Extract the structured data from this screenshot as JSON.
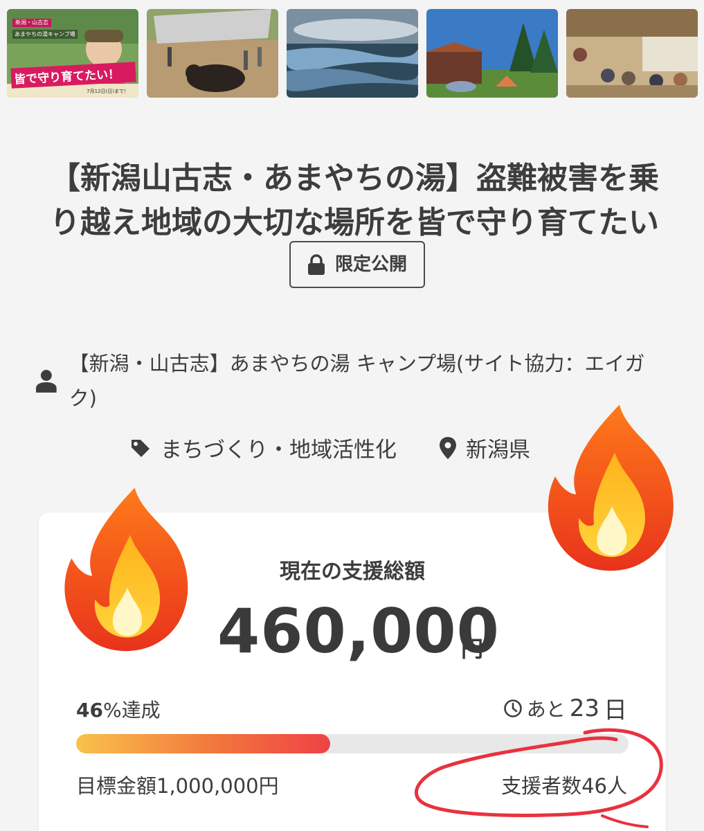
{
  "thumbnails": [
    {
      "name": "campaign-banner",
      "tag": "新潟・山古志",
      "subtitle": "あまやちの湯キャンプ場",
      "banner": "皆で守り育てたい！",
      "date": "7月12日(日)まで！"
    },
    {
      "name": "bullfighting-photo"
    },
    {
      "name": "rice-terraces-photo"
    },
    {
      "name": "campsite-cabin-photo"
    },
    {
      "name": "community-hall-photo"
    }
  ],
  "project": {
    "title": "【新潟山古志・あまやちの湯】盗難被害を乗り越え地域の大切な場所を皆で守り育てたい",
    "badge": "限定公開",
    "owner": "【新潟・山古志】あまやちの湯 キャンプ場(サイト協力：エイガク)",
    "category": "まちづくり・地域活性化",
    "location": "新潟県"
  },
  "funding": {
    "label": "現在の支援総額",
    "amount": "460,000",
    "currency": "円",
    "percent": "46",
    "percent_suffix": "%達成",
    "progress": 0.46,
    "remaining_prefix": "あと",
    "remaining_days": "23",
    "remaining_suffix": "日",
    "goal": "目標金額1,000,000円",
    "supporters": "支援者数46人"
  },
  "colors": {
    "bar_start": "#f9c24a",
    "bar_end": "#ef4246",
    "scribble": "#e8323f"
  },
  "icons": [
    "lock-icon",
    "person-icon",
    "tag-icon",
    "location-pin-icon",
    "clock-icon",
    "fire-emoji"
  ]
}
